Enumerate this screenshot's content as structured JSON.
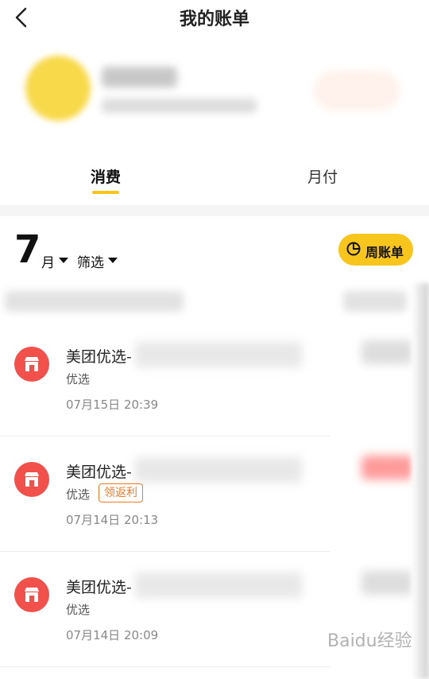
{
  "header": {
    "title": "我的账单"
  },
  "tabs": [
    {
      "label": "消费",
      "active": true
    },
    {
      "label": "月付",
      "active": false
    }
  ],
  "filter": {
    "month_number": "7",
    "month_unit": "月",
    "filter_label": "筛选",
    "weekly_bill_label": "周账单"
  },
  "items": [
    {
      "title": "美团优选-",
      "subtitle": "优选",
      "date": "07月15日 20:39",
      "badge": ""
    },
    {
      "title": "美团优选-",
      "subtitle": "优选",
      "date": "07月14日 20:13",
      "badge": "领返利"
    },
    {
      "title": "美团优选-",
      "subtitle": "优选",
      "date": "07月14日 20:09",
      "badge": ""
    }
  ],
  "watermark": "Baidu经验",
  "colors": {
    "accent": "#f8c51c",
    "store_icon": "#f2504a",
    "badge": "#f07a2a"
  }
}
